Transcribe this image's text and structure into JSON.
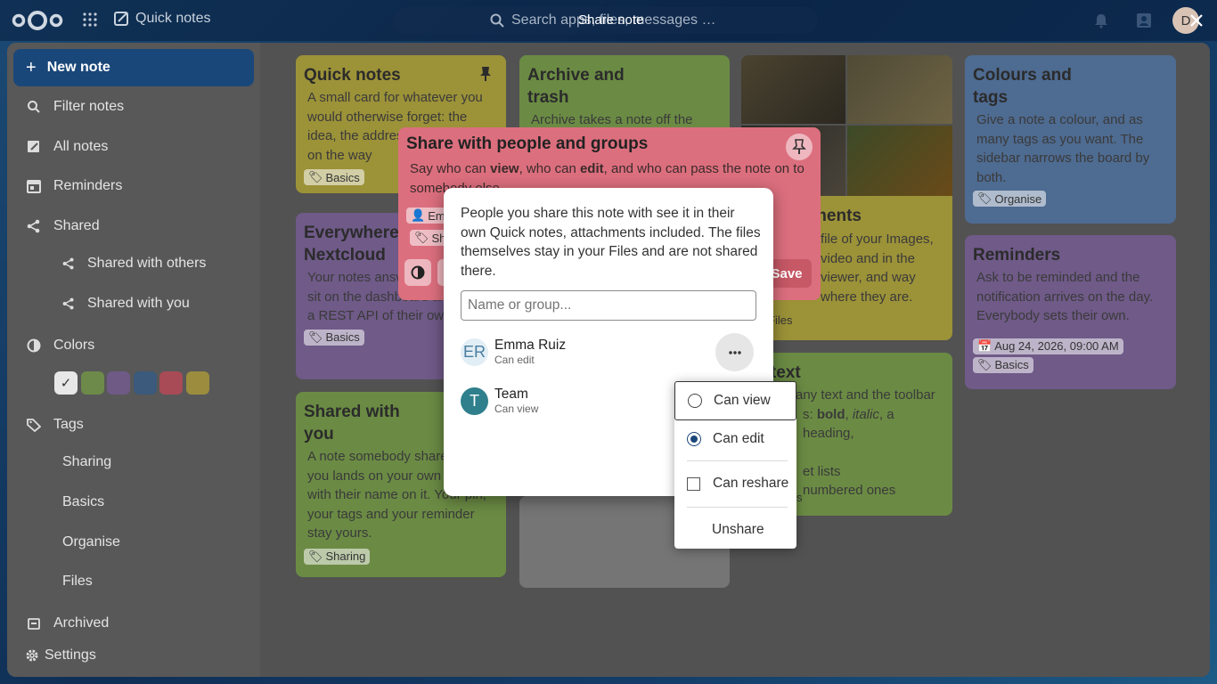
{
  "header": {
    "app_name": "Quick notes",
    "search_placeholder": "Search apps, files, messages …",
    "modal_title": "Share note",
    "avatar_initial": "D"
  },
  "sidebar": {
    "new_note": "New note",
    "filter": "Filter notes",
    "all_notes": "All notes",
    "reminders": "Reminders",
    "shared": "Shared",
    "shared_with_others": "Shared with others",
    "shared_with_you": "Shared with you",
    "colors": "Colors",
    "tags": "Tags",
    "tag_items": [
      "Sharing",
      "Basics",
      "Organise",
      "Files"
    ],
    "archived": "Archived",
    "settings": "Settings",
    "swatch_colors": [
      "#6d8a4a",
      "#6f5a86",
      "#3b5a7c",
      "#a84b56",
      "#9c8d3e"
    ]
  },
  "cards": {
    "quick_notes": {
      "title": "Quick notes",
      "body": "A small card for whatever you would otherwise forget: the idea, the address, what to buy on the way",
      "tag": "Basics"
    },
    "archive": {
      "title_1": "Archive and",
      "title_2": "trash",
      "body": "Archive takes a note off the"
    },
    "colours": {
      "title_1": "Colours and",
      "title_2": "tags",
      "body": "Give a note a colour, and as many tags as you want. The sidebar narrows the board by both.",
      "tag": "Organise"
    },
    "everywhere": {
      "title_1": "Everywhere",
      "title_2": "Nextcloud",
      "body": "Your notes answer in search, sit on the dashboard and have a REST API of their own.",
      "tag": "Basics"
    },
    "attachments": {
      "title": "ments",
      "body": "file of your Images, video and in the viewer, and way where they are.",
      "tag": "Files"
    },
    "reminders": {
      "title": "Reminders",
      "body": "Ask to be reminded and the notification arrives on the day. Everybody sets their own.",
      "date": "Aug 24, 2026, 09:00 AM",
      "tag": "Basics"
    },
    "rich_text": {
      "title": "h text",
      "body_1": "any text and the toolbar",
      "body_2a": "s: ",
      "bold": "bold",
      "sep": ", ",
      "italic": "italic",
      "body_2b": ", a heading,",
      "body_3": "et lists",
      "body_4": "numbered ones",
      "tag": "s"
    },
    "shared_with_you": {
      "title_1": "Shared with",
      "title_2": "you",
      "body": "A note somebody shares with you lands on your own board with their name on it. Your pin, your tags and your reminder stay yours.",
      "tag": "Sharing"
    }
  },
  "share_card": {
    "title": "Share with people and groups",
    "desc_1": "Say who can ",
    "view": "view",
    "desc_2": ", who can ",
    "edit": "edit",
    "desc_3": ", and who can pass the note on to somebody else.",
    "chip_person": "Emma Ruiz",
    "chip_tag": "Sharing",
    "save": "Save"
  },
  "dialog": {
    "text": "People you share this note with see it in their own Quick notes, attachments included. The files themselves stay in your Files and are not shared there.",
    "input_placeholder": "Name or group...",
    "people": [
      {
        "initials": "ER",
        "name": "Emma Ruiz",
        "role": "Can edit"
      },
      {
        "initials": "T",
        "name": "Team",
        "role": "Can view"
      }
    ]
  },
  "menu": {
    "can_view": "Can view",
    "can_edit": "Can edit",
    "can_reshare": "Can reshare",
    "unshare": "Unshare",
    "selected": "Can edit"
  }
}
